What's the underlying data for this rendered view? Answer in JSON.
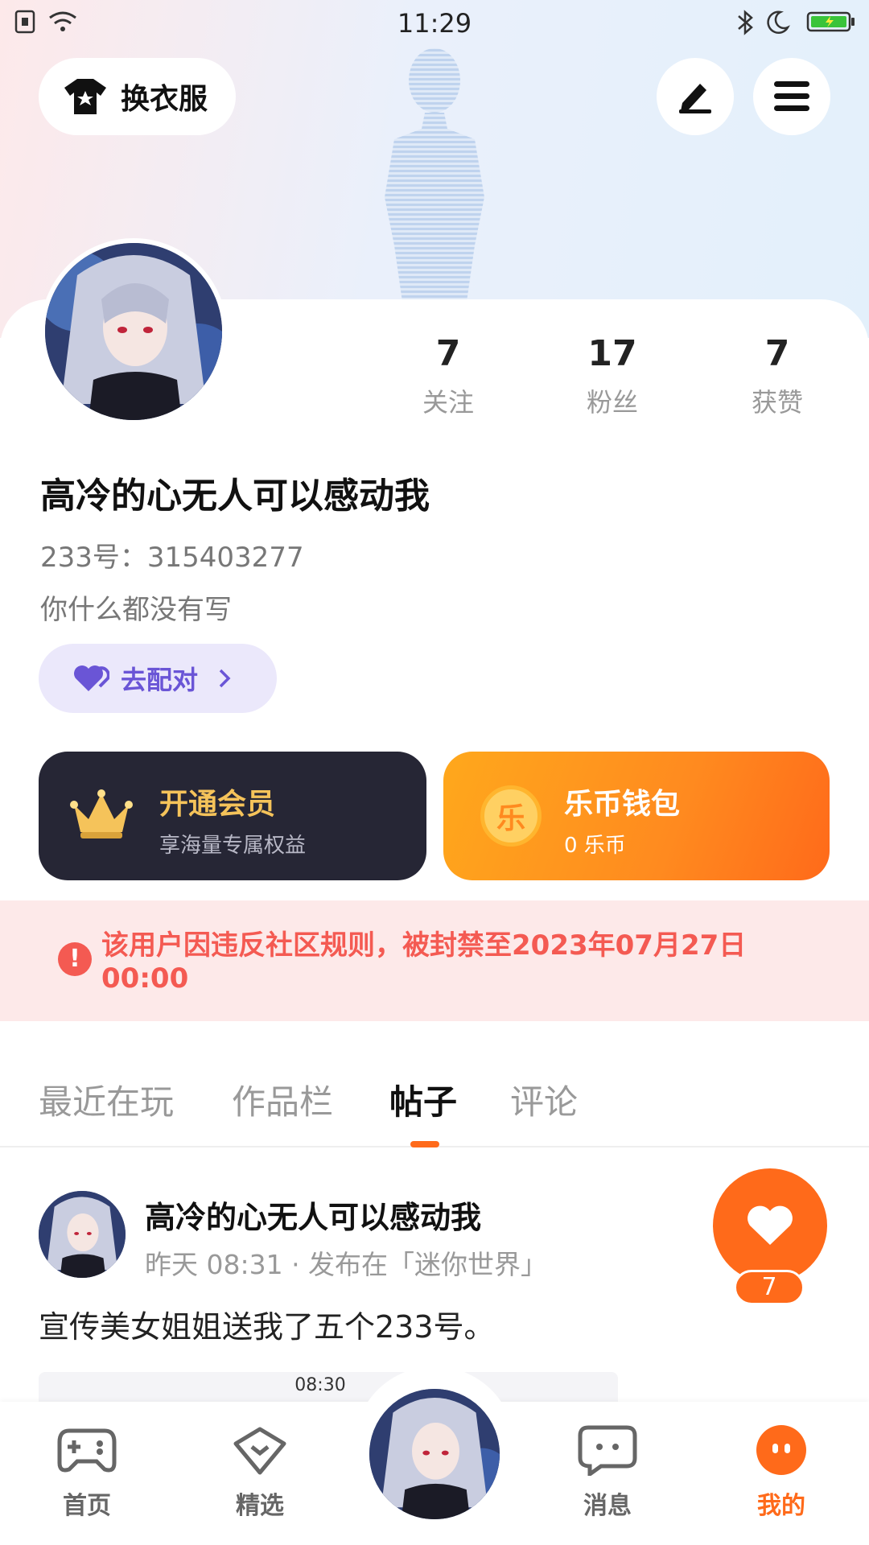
{
  "status_bar": {
    "time": "11:29"
  },
  "header": {
    "dress_up_label": "换衣服"
  },
  "profile": {
    "stats": [
      {
        "value": "7",
        "label": "关注"
      },
      {
        "value": "17",
        "label": "粉丝"
      },
      {
        "value": "7",
        "label": "获赞"
      }
    ],
    "name": "高冷的心无人可以感动我",
    "uid": "233号：315403277",
    "bio": "你什么都没有写",
    "match_label": "去配对"
  },
  "promos": {
    "vip_title": "开通会员",
    "vip_sub": "享海量专属权益",
    "wallet_title": "乐币钱包",
    "wallet_sub": "0 乐币",
    "wallet_coin_char": "乐"
  },
  "ban_notice": "该用户因违反社区规则，被封禁至2023年07月27日00:00",
  "tabs": [
    "最近在玩",
    "作品栏",
    "帖子",
    "评论"
  ],
  "active_tab": "帖子",
  "post": {
    "author": "高冷的心无人可以感动我",
    "meta": "昨天 08:31 · 发布在「迷你世界」",
    "body": "宣传美女姐姐送我了五个233号。",
    "like_count": "7",
    "preview_time": "08:30"
  },
  "nav": {
    "items": [
      {
        "label": "首页",
        "icon": "gamepad-icon"
      },
      {
        "label": "精选",
        "icon": "heart-badge-icon"
      },
      {
        "label": "消息",
        "icon": "chat-icon"
      },
      {
        "label": "我的",
        "icon": "profile-dots-icon"
      }
    ],
    "active": "我的"
  },
  "colors": {
    "accent": "#ff6a1a",
    "ban_text": "#f45a52",
    "match_text": "#6a55d6",
    "vip_gold": "#f5c35a"
  }
}
